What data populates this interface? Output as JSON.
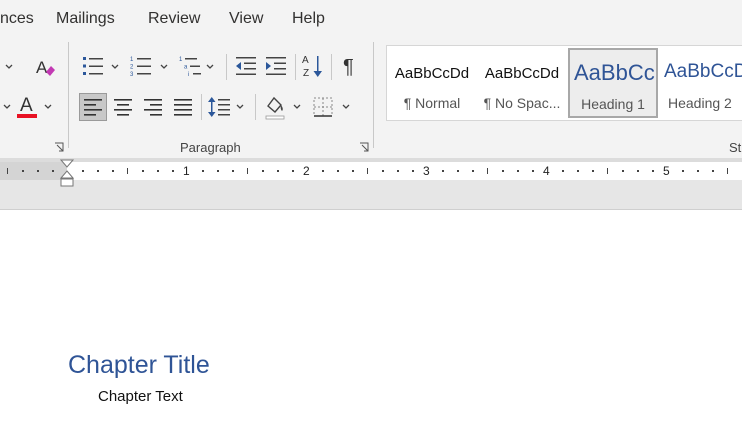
{
  "menu": [
    "nces",
    "Mailings",
    "Review",
    "View",
    "Help"
  ],
  "ribbon": {
    "paragraph_label": "Paragraph",
    "styles_label": "St",
    "font_color_letter": "A",
    "colors": {
      "font_color": "#e81123",
      "accent": "#2b579a",
      "selected_btn": "#c8c8c8"
    }
  },
  "styles": [
    {
      "sample": "AaBbCcDd",
      "name": "¶ Normal"
    },
    {
      "sample": "AaBbCcDd",
      "name": "¶ No Spac..."
    },
    {
      "sample": "AaBbCc",
      "name": "Heading 1"
    },
    {
      "sample": "AaBbCcD",
      "name": "Heading 2"
    }
  ],
  "ruler": {
    "numbers": [
      "1",
      "2",
      "3",
      "4",
      "5"
    ]
  },
  "document": {
    "title": "Chapter Title",
    "body": "Chapter Text"
  }
}
